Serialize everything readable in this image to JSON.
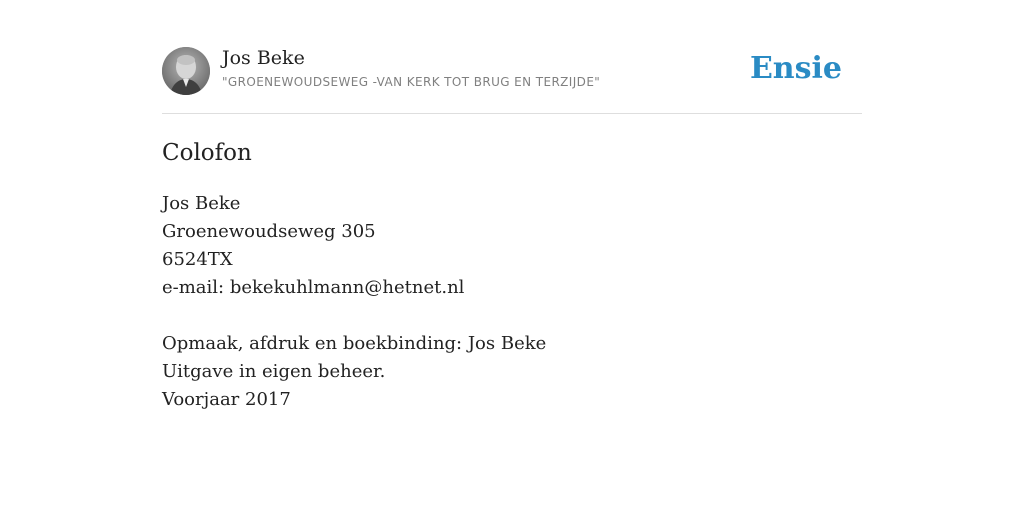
{
  "header": {
    "avatar_icon": "portrait-photo",
    "author_name": "Jos Beke",
    "subtitle": "\"GROENEWOUDSEWEG -VAN KERK TOT BRUG EN TERZIJDE\"",
    "brand": "Ensie",
    "brand_color": "#2a8bc4"
  },
  "section": {
    "title": "Colofon"
  },
  "contact": {
    "name": "Jos Beke",
    "street": "Groenewoudseweg 305",
    "postcode": "6524TX",
    "email": "e-mail: bekekuhlmann@hetnet.nl"
  },
  "credits": {
    "production": "Opmaak, afdruk en boekbinding: Jos Beke",
    "publisher": "Uitgave in eigen beheer.",
    "date": "Voorjaar 2017"
  }
}
